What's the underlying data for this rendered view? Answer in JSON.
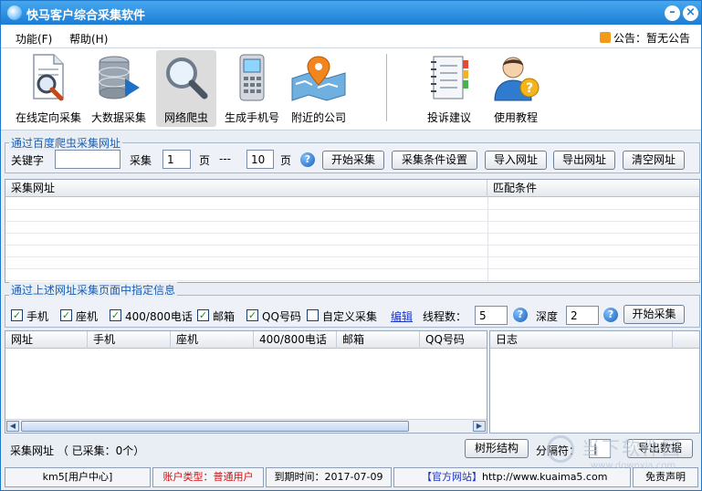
{
  "window": {
    "title": "快马客户综合采集软件"
  },
  "menu": [
    {
      "label": "功能(F)"
    },
    {
      "label": "帮助(H)"
    }
  ],
  "notice": {
    "text": "公告：暂无公告"
  },
  "toolbar": [
    {
      "label": "在线定向采集",
      "icon": "document-search-icon"
    },
    {
      "label": "大数据采集",
      "icon": "database-icon"
    },
    {
      "label": "网络爬虫",
      "icon": "magnifier-icon",
      "active": true
    },
    {
      "label": "生成手机号",
      "icon": "phone-icon"
    },
    {
      "label": "附近的公司",
      "icon": "map-pin-icon"
    },
    {
      "label": "投诉建议",
      "icon": "notebook-icon"
    },
    {
      "label": "使用教程",
      "icon": "user-help-icon"
    }
  ],
  "crawl": {
    "group_title": "通过百度爬虫采集网址",
    "keyword_label": "关键字",
    "keyword_value": "",
    "collect_label": "采集",
    "page_from": "1",
    "page_label": "页",
    "dash": "---",
    "page_to": "10",
    "page_label2": "页",
    "buttons": {
      "start": "开始采集",
      "conditions": "采集条件设置",
      "import": "导入网址",
      "export": "导出网址",
      "clear": "清空网址"
    }
  },
  "url_table": {
    "columns": [
      "采集网址",
      "匹配条件"
    ]
  },
  "extract": {
    "group_title": "通过上述网址采集页面中指定信息",
    "checks": [
      {
        "label": "手机",
        "checked": true
      },
      {
        "label": "座机",
        "checked": true
      },
      {
        "label": "400/800电话",
        "checked": true
      },
      {
        "label": "邮箱",
        "checked": true
      },
      {
        "label": "QQ号码",
        "checked": true
      },
      {
        "label": "自定义采集",
        "checked": false
      }
    ],
    "edit_link": "编辑",
    "threads_label": "线程数：",
    "threads_value": "5",
    "depth_label": "深度",
    "depth_value": "2",
    "start_button": "开始采集"
  },
  "result_table": {
    "columns": [
      "网址",
      "手机",
      "座机",
      "400/800电话",
      "邮箱",
      "QQ号码"
    ]
  },
  "log_table": {
    "columns": [
      "日志"
    ]
  },
  "bottom": {
    "summary": "采集网址 （ 已采集：0个）",
    "tree_button": "树形结构",
    "separator_label": "分隔符：",
    "separator_value": "|",
    "export_button": "导出数据"
  },
  "statusbar": {
    "user": "km5[用户中心]",
    "account": "账户类型：普通用户",
    "expire": "到期时间：2017-07-09",
    "site_label": "【官方网站】",
    "site_url": "http://www.kuaima5.com",
    "disclaimer": "免责声明"
  },
  "watermark": {
    "text": "当下软件园",
    "url": "www.downxia.com"
  },
  "colors": {
    "accent": "#1b7ed6",
    "account_text": "#d01010",
    "link": "#1a33c8"
  }
}
